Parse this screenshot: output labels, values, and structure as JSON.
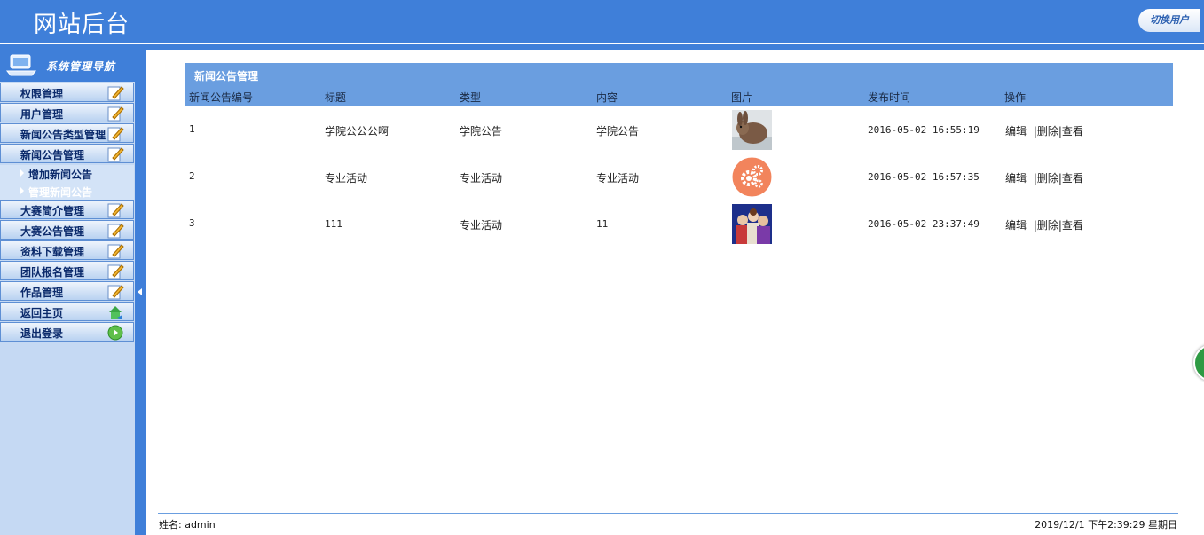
{
  "header": {
    "title": "网站后台",
    "switch_user": "切换用户"
  },
  "sidebar": {
    "title": "系统管理导航",
    "items": [
      {
        "label": "权限管理",
        "icon": "edit-icon"
      },
      {
        "label": "用户管理",
        "icon": "edit-icon"
      },
      {
        "label": "新闻公告类型管理",
        "icon": "edit-icon"
      },
      {
        "label": "新闻公告管理",
        "icon": "edit-icon"
      },
      {
        "label": "大赛简介管理",
        "icon": "edit-icon"
      },
      {
        "label": "大赛公告管理",
        "icon": "edit-icon"
      },
      {
        "label": "资料下载管理",
        "icon": "edit-icon"
      },
      {
        "label": "团队报名管理",
        "icon": "edit-icon"
      },
      {
        "label": "作品管理",
        "icon": "edit-icon"
      },
      {
        "label": "返回主页",
        "icon": "home-icon"
      },
      {
        "label": "退出登录",
        "icon": "exit-icon"
      }
    ],
    "subitems": [
      {
        "label": "增加新闻公告"
      },
      {
        "label": "管理新闻公告"
      }
    ]
  },
  "panel": {
    "title": "新闻公告管理",
    "columns": [
      "新闻公告编号",
      "标题",
      "类型",
      "内容",
      "图片",
      "发布时间",
      "操作"
    ]
  },
  "rows": [
    {
      "id": "1",
      "title": "学院公公公啊",
      "type": "学院公告",
      "content": "学院公告",
      "image": "rabbit-photo",
      "time": "2016-05-02 16:55:19"
    },
    {
      "id": "2",
      "title": "专业活动",
      "type": "专业活动",
      "content": "专业活动",
      "image": "gears-icon",
      "time": "2016-05-02 16:57:35"
    },
    {
      "id": "3",
      "title": "111",
      "type": "专业活动",
      "content": "11",
      "image": "group-photo",
      "time": "2016-05-02 23:37:49"
    }
  ],
  "actions": {
    "edit": "编辑",
    "delete": "|删除",
    "view": "|查看"
  },
  "footer": {
    "user_label": "姓名: admin",
    "datetime": "2019/12/1 下午2:39:29 星期日"
  },
  "colors": {
    "header": "#3f7fd9",
    "panel": "#6a9ee0",
    "sidebar": "#c5d9f3"
  }
}
